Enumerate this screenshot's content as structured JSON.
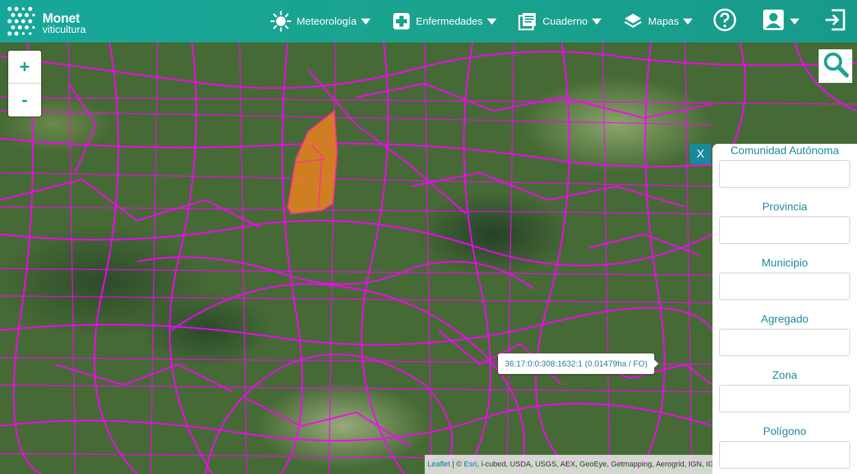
{
  "brand": {
    "name": "Monet",
    "subtitle": "viticultura"
  },
  "nav": {
    "meteorologia": "Meteorología",
    "enfermedades": "Enfermedades",
    "cuaderno": "Cuaderno",
    "mapas": "Mapas"
  },
  "map_controls": {
    "zoom_in": "+",
    "zoom_out": "-"
  },
  "panel": {
    "close_label": "X",
    "fields": {
      "comunidad": "Comunidad Autónoma",
      "provincia": "Provincia",
      "municipio": "Municipio",
      "agregado": "Agregado",
      "zona": "Zona",
      "poligono": "Polígono"
    }
  },
  "tooltip": "36:17:0:0:308:1632:1 (0.01479ha / FO)",
  "attribution": {
    "leaflet": "Leaflet",
    "separator": " | © ",
    "esri": "Esri",
    "rest": ", i-cubed, USDA, USGS, AEX, GeoEye, Getmapping, Aerogrid, IGN, IGP, UPR-EGP, and the GIS User Community"
  },
  "colors": {
    "header": "#1aa38f",
    "accent": "#1b8a9a",
    "parcel_border": "#ff00ff",
    "selected_parcel": "#e8821f"
  },
  "icons": [
    "sun-icon",
    "plus-cross-icon",
    "notebook-icon",
    "layers-icon",
    "help-icon",
    "user-icon",
    "logout-icon",
    "search-icon"
  ]
}
